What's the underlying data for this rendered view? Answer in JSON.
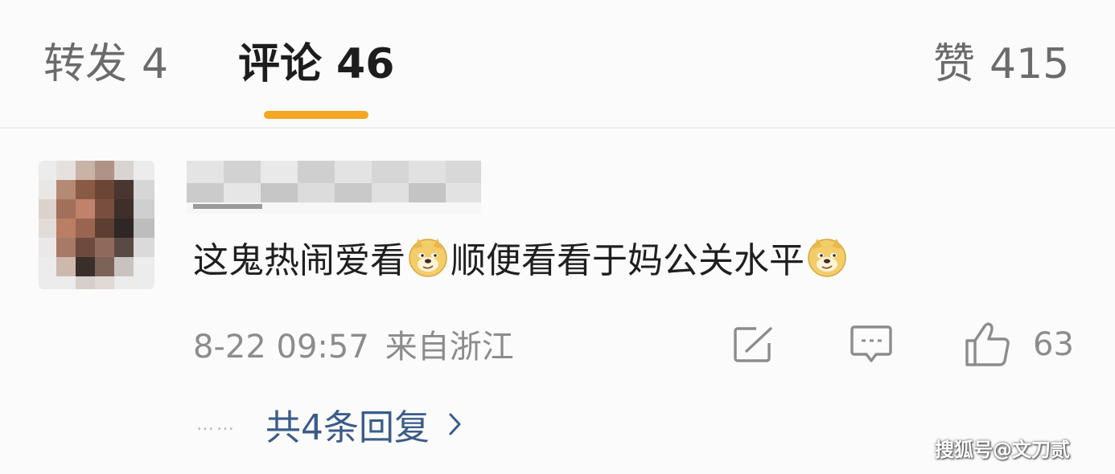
{
  "tabs": {
    "repost": {
      "label": "转发",
      "count": "4"
    },
    "comments": {
      "label": "评论",
      "count": "46"
    },
    "likes": {
      "label": "赞",
      "count": "415"
    },
    "active": "comments"
  },
  "comment": {
    "avatar_icon": "blurred-avatar-icon",
    "username_icon": "blurred-username-icon",
    "text_parts": [
      "这鬼热闹爱看",
      "顺便看看于妈公关水平"
    ],
    "emoji": "doge-emoji-icon",
    "date": "8-22 09:57",
    "location": "来自浙江",
    "like_count": "63",
    "replies": {
      "dots": "……",
      "label": "共4条回复"
    }
  },
  "colors": {
    "accent_underline": "#f5a623",
    "reply_link": "#3a5c8a",
    "meta_text": "#8c8c8c"
  },
  "watermark": "搜狐号@文刀贰"
}
